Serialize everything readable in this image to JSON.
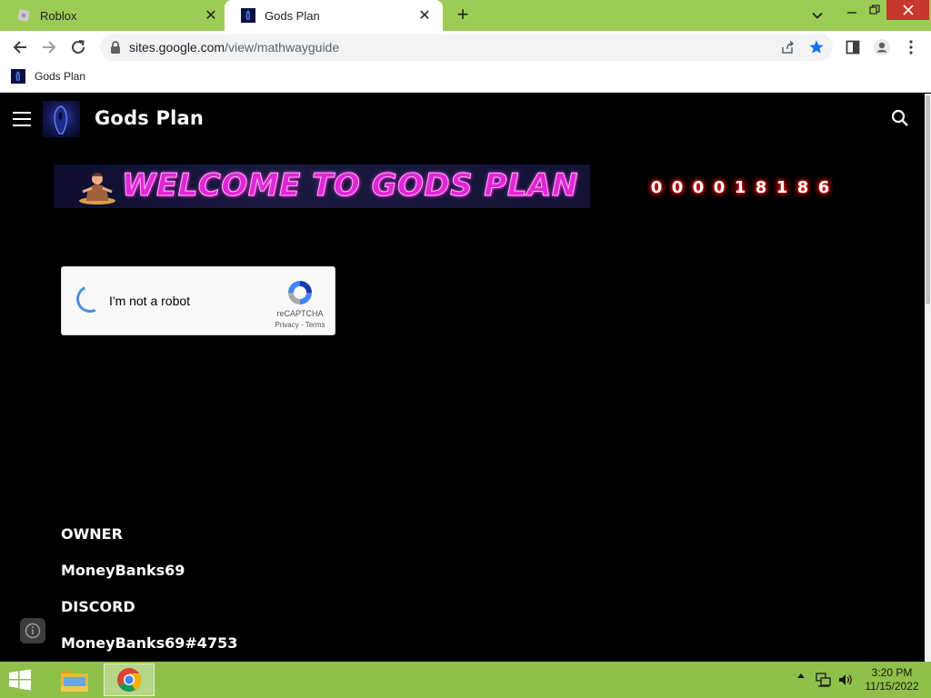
{
  "browser": {
    "tabs": [
      {
        "title": "Roblox",
        "active": false
      },
      {
        "title": "Gods Plan",
        "active": true
      }
    ],
    "new_tab_label": "+",
    "url_host": "sites.google.com",
    "url_path": "/view/mathwayguide",
    "bookmarks": [
      {
        "label": "Gods Plan"
      }
    ],
    "colors": {
      "tabstrip": "#9ccc55",
      "close_button": "#c8372d",
      "star": "#1a73e8"
    }
  },
  "site": {
    "title": "Gods Plan",
    "banner_text": "WELCOME TO GODS PLAN",
    "counter_digits": [
      "0",
      "0",
      "0",
      "0",
      "1",
      "8",
      "1",
      "8",
      "6"
    ],
    "recaptcha": {
      "label": "I'm not a robot",
      "brand": "reCAPTCHA",
      "privacy": "Privacy",
      "separator": " - ",
      "terms": "Terms"
    },
    "info_lines": [
      "OWNER",
      "MoneyBanks69",
      "DISCORD",
      "MoneyBanks69#4753"
    ],
    "colors": {
      "background": "#000000",
      "banner_text": "#e027d6",
      "counter_glow": "#ff2222"
    }
  },
  "taskbar": {
    "time": "3:20 PM",
    "date": "11/15/2022",
    "color": "#8fc049"
  }
}
